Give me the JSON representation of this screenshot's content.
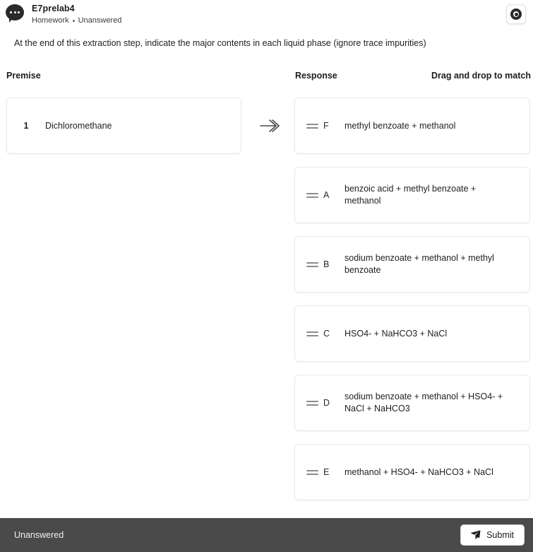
{
  "header": {
    "avatar_icon": "speech-bubble-ellipsis-icon",
    "title": "E7prelab4",
    "type": "Homework",
    "status": "Unanswered",
    "action_icon": "target-dot-icon"
  },
  "prompt": {
    "text": "At the end of this extraction step, indicate the major contents in each liquid phase (ignore trace impurities)"
  },
  "columns": {
    "premise_label": "Premise",
    "response_label": "Response",
    "hint_label": "Drag and drop to match"
  },
  "arrow_icon": "arrow-right-icon",
  "premises": [
    {
      "number": "1",
      "text": "Dichloromethane"
    }
  ],
  "responses": [
    {
      "handle_icon": "drag-handle-icon",
      "letter": "F",
      "text": "methyl benzoate + methanol"
    },
    {
      "handle_icon": "drag-handle-icon",
      "letter": "A",
      "text": "benzoic acid + methyl benzoate + methanol"
    },
    {
      "handle_icon": "drag-handle-icon",
      "letter": "B",
      "text": "sodium benzoate + methanol + methyl benzoate"
    },
    {
      "handle_icon": "drag-handle-icon",
      "letter": "C",
      "text": "HSO4- + NaHCO3 + NaCl"
    },
    {
      "handle_icon": "drag-handle-icon",
      "letter": "D",
      "text": "sodium benzoate + methanol + HSO4- + NaCl + NaHCO3"
    },
    {
      "handle_icon": "drag-handle-icon",
      "letter": "E",
      "text": "methanol + HSO4- + NaHCO3 + NaCl"
    }
  ],
  "footer": {
    "status": "Unanswered",
    "submit_label": "Submit",
    "submit_icon": "paper-plane-icon",
    "bar_color": "#4a4a4a"
  }
}
